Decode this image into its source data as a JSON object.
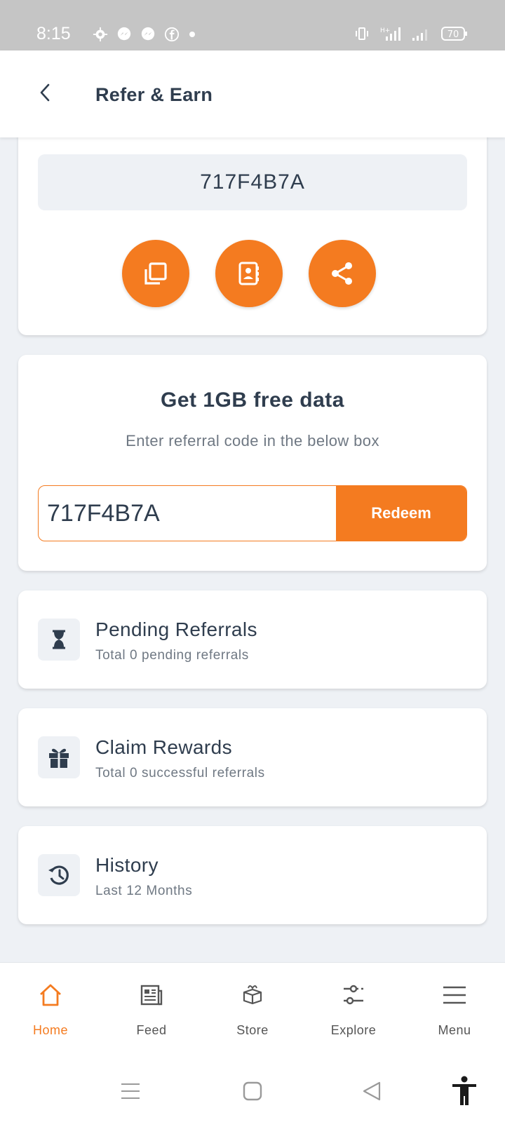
{
  "status_bar": {
    "time": "8:15",
    "battery": "70"
  },
  "header": {
    "title": "Refer & Earn"
  },
  "referral": {
    "code": "717F4B7A",
    "actions": [
      {
        "icon": "copy-icon"
      },
      {
        "icon": "contacts-icon"
      },
      {
        "icon": "share-icon"
      }
    ]
  },
  "redeem": {
    "title": "Get 1GB free data",
    "subtitle": "Enter referral code in the below box",
    "input_value": "717F4B7A",
    "button_label": "Redeem"
  },
  "list": [
    {
      "title": "Pending Referrals",
      "subtitle": "Total 0 pending referrals",
      "icon": "hourglass-icon"
    },
    {
      "title": "Claim Rewards",
      "subtitle": "Total 0 successful referrals",
      "icon": "gift-icon"
    },
    {
      "title": "History",
      "subtitle": "Last 12 Months",
      "icon": "history-icon"
    }
  ],
  "bottom_nav": [
    {
      "label": "Home",
      "icon": "home-icon",
      "active": true
    },
    {
      "label": "Feed",
      "icon": "feed-icon",
      "active": false
    },
    {
      "label": "Store",
      "icon": "store-icon",
      "active": false
    },
    {
      "label": "Explore",
      "icon": "explore-icon",
      "active": false
    },
    {
      "label": "Menu",
      "icon": "menu-icon",
      "active": false
    }
  ],
  "colors": {
    "accent": "#f47b20",
    "text_dark": "#2f3d4e",
    "text_muted": "#6f7883",
    "background": "#eef1f5"
  }
}
